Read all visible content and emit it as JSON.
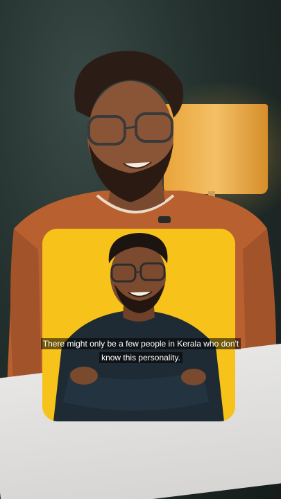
{
  "caption": {
    "text": "There might only be a few people in Kerala who don't know this personality."
  },
  "colors": {
    "background": "#23302d",
    "lamp": "#f0b24a",
    "shirt_presenter": "#b8602f",
    "inset_background": "#f7c21a",
    "shirt_inset": "#1f2b34",
    "desk": "#e2e1df"
  }
}
